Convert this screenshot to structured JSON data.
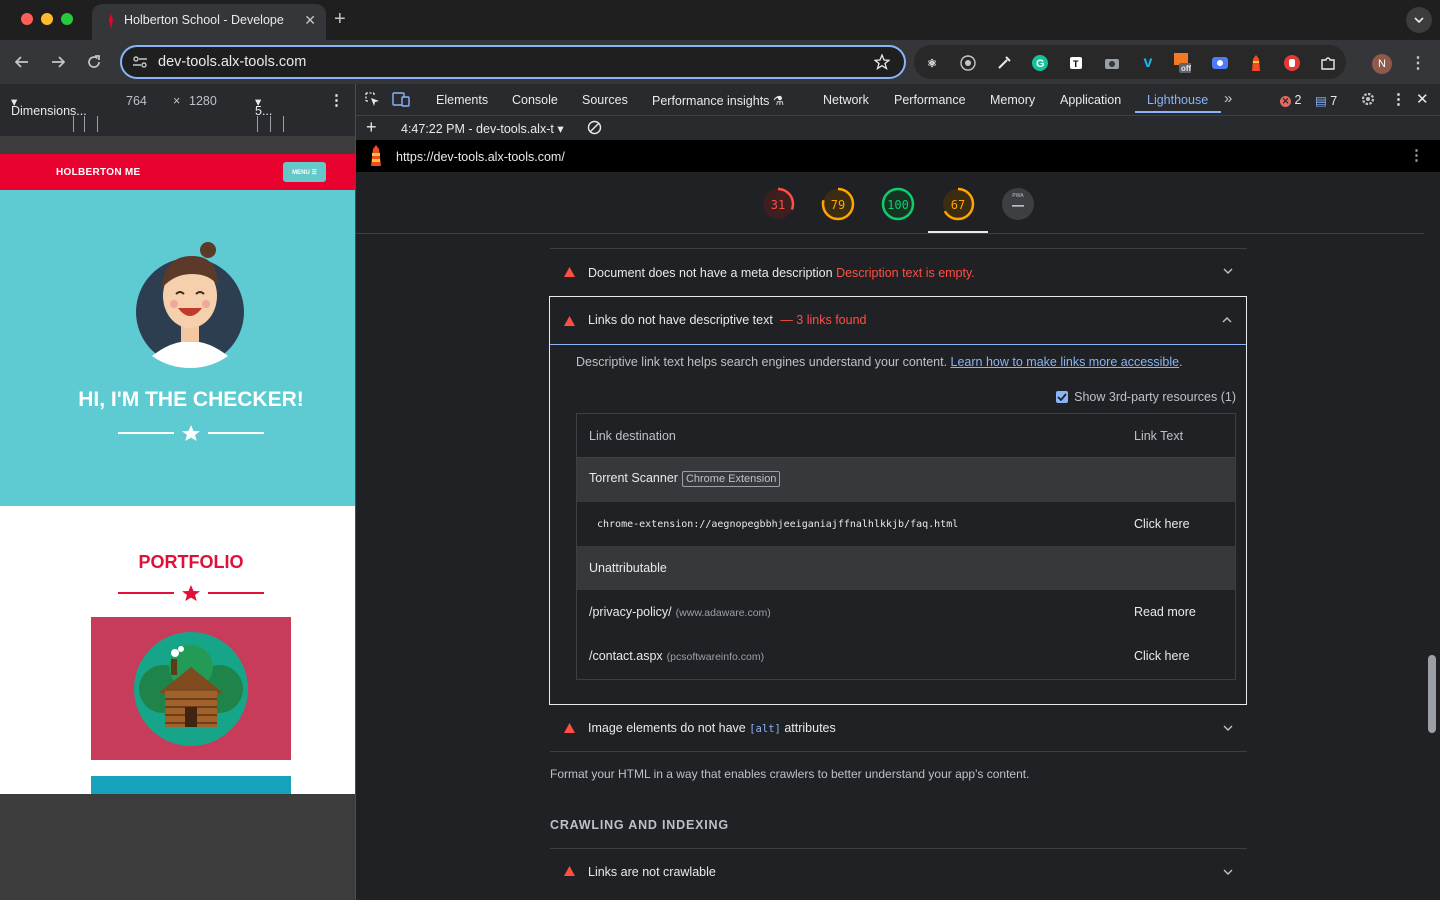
{
  "browser": {
    "tab_title": "Holberton School - Develope",
    "url": "dev-tools.alx-tools.com",
    "avatar_initial": "N",
    "ext_off_badge": "off"
  },
  "device_toolbar": {
    "device": "Dimensions...",
    "width": "764",
    "times": "×",
    "height": "1280",
    "zoom": "5..."
  },
  "site": {
    "brand": "HOLBERTON ME",
    "menu_label": "MENU ☰",
    "hero_title": "HI, I'M THE CHECKER!",
    "portfolio_title": "PORTFOLIO"
  },
  "devtools": {
    "tabs": [
      "Elements",
      "Console",
      "Sources",
      "Performance insights",
      "Network",
      "Performance",
      "Memory",
      "Application",
      "Lighthouse"
    ],
    "error_count": "2",
    "message_count": "7",
    "report_selector": "4:47:22 PM - dev-tools.alx-t",
    "report_url": "https://dev-tools.alx-tools.com/"
  },
  "lighthouse": {
    "scores": [
      {
        "value": "31",
        "color": "#ff4e42"
      },
      {
        "value": "79",
        "color": "#ffa400"
      },
      {
        "value": "100",
        "color": "#0cce6b"
      },
      {
        "value": "67",
        "color": "#ffa400"
      }
    ],
    "pwa_label": "PWA",
    "pwa_value": "—",
    "audits": {
      "meta_desc_title": "Document does not have a meta description",
      "meta_desc_detail": "Description text is empty.",
      "links_title": "Links do not have descriptive text",
      "links_detail": "— 3 links found",
      "links_description": "Descriptive link text helps search engines understand your content.",
      "links_learn_more": "Learn how to make links more accessible",
      "third_party_label": "Show 3rd-party resources (1)",
      "img_alt_before": "Image elements do not have",
      "img_alt_code": "[alt]",
      "img_alt_after": "attributes",
      "crawlable_title": "Links are not crawlable"
    },
    "table": {
      "col_destination": "Link destination",
      "col_text": "Link Text",
      "group1_name": "Torrent Scanner",
      "group1_chip": "Chrome Extension",
      "row1_dest": "chrome-extension://aegnopegbbhjeeiganiajffnalhlkkjb/faq.html",
      "row1_text": "Click here",
      "group2_name": "Unattributable",
      "row2_dest": "/privacy-policy/",
      "row2_host": "(www.adaware.com)",
      "row2_text": "Read more",
      "row3_dest": "/contact.aspx",
      "row3_host": "(pcsoftwareinfo.com)",
      "row3_text": "Click here"
    },
    "section_description": "Format your HTML in a way that enables crawlers to better understand your app's content.",
    "section_heading": "CRAWLING AND INDEXING"
  }
}
